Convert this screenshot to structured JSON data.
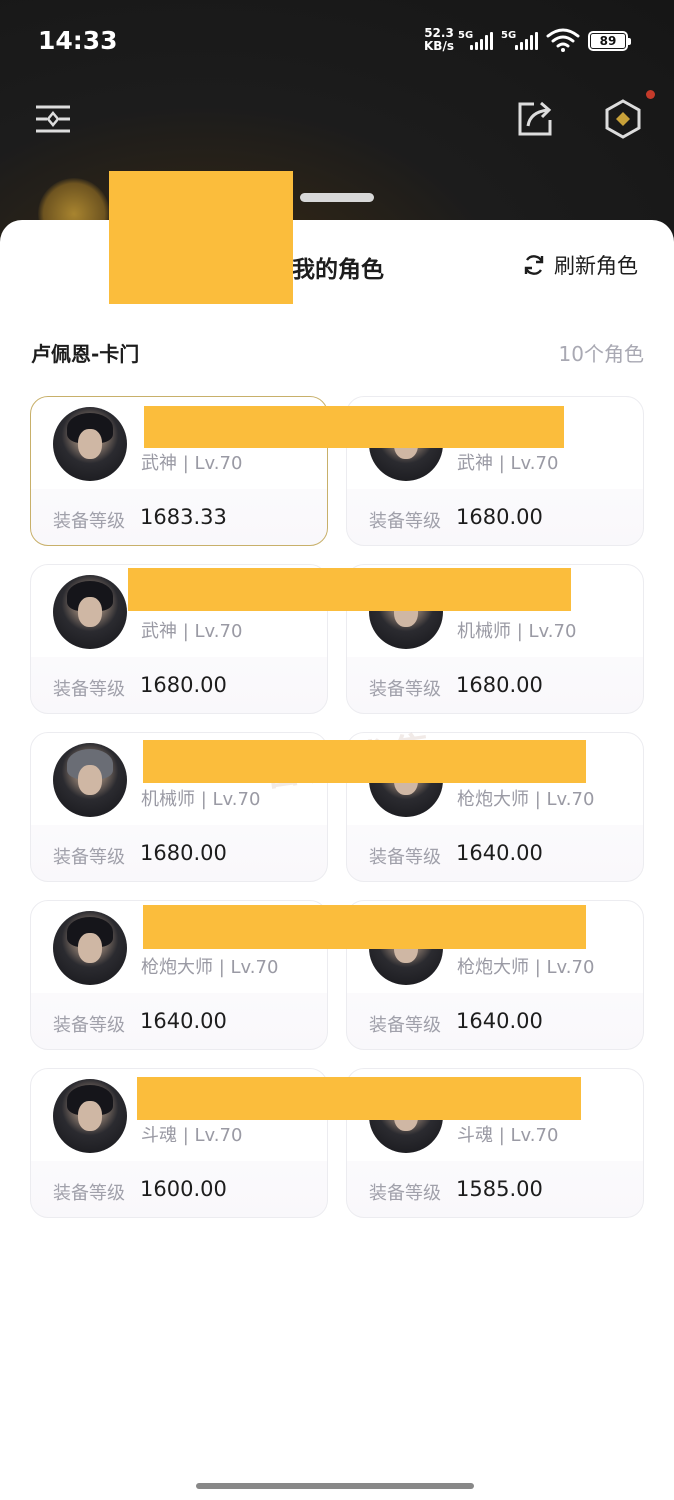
{
  "status_bar": {
    "time": "14:33",
    "net_speed_value": "52.3",
    "net_speed_unit": "KB/s",
    "signal1_label": "5G",
    "signal2_label": "5G",
    "battery": "89"
  },
  "header": {
    "menu_icon": "menu-lines-icon",
    "share_icon": "share-icon",
    "settings_icon": "hexagon-settings-icon",
    "notification_dot_color": "#c43a2a"
  },
  "sheet": {
    "title": "我的角色",
    "refresh_label": "刷新角色",
    "server_name": "卢佩恩-卡门",
    "role_count": "10个角色",
    "equip_label": "装备等级",
    "watermark": "番茄代售"
  },
  "characters": [
    {
      "class_level": "武神 | Lv.70",
      "equip_level": "1683.33"
    },
    {
      "class_level": "武神 | Lv.70",
      "equip_level": "1680.00"
    },
    {
      "class_level": "武神 | Lv.70",
      "equip_level": "1680.00"
    },
    {
      "class_level": "机械师 | Lv.70",
      "equip_level": "1680.00"
    },
    {
      "class_level": "机械师 | Lv.70",
      "equip_level": "1680.00"
    },
    {
      "class_level": "枪炮大师 | Lv.70",
      "equip_level": "1640.00"
    },
    {
      "class_level": "枪炮大师 | Lv.70",
      "equip_level": "1640.00"
    },
    {
      "class_level": "枪炮大师 | Lv.70",
      "equip_level": "1640.00"
    },
    {
      "class_level": "斗魂 | Lv.70",
      "equip_level": "1600.00"
    },
    {
      "class_level": "斗魂 | Lv.70",
      "equip_level": "1585.00"
    }
  ],
  "colors": {
    "redaction": "#fbbd3c",
    "selected_border": "#c8b06a"
  }
}
